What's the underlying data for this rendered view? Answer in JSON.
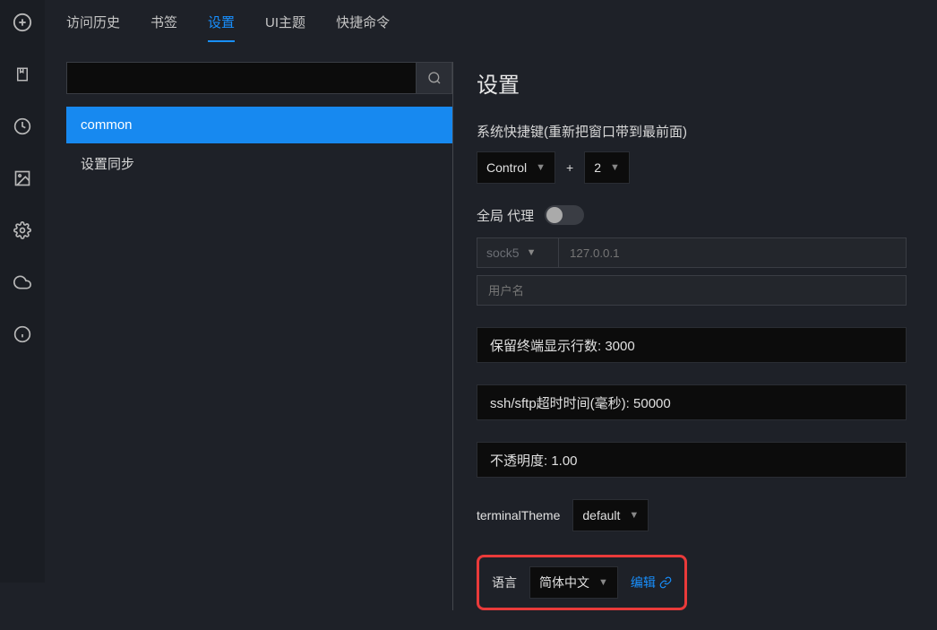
{
  "rail": {
    "icons": [
      "add-circle",
      "bookmark",
      "clock",
      "image",
      "gear",
      "cloud-sync",
      "info"
    ]
  },
  "tabs": [
    {
      "id": "history",
      "label": "访问历史",
      "active": false
    },
    {
      "id": "bookmarks",
      "label": "书签",
      "active": false
    },
    {
      "id": "settings",
      "label": "设置",
      "active": true
    },
    {
      "id": "themes",
      "label": "UI主题",
      "active": false
    },
    {
      "id": "quick",
      "label": "快捷命令",
      "active": false
    }
  ],
  "sidebar": {
    "items": [
      {
        "id": "common",
        "label": "common",
        "active": true
      },
      {
        "id": "sync",
        "label": "设置同步",
        "active": false
      }
    ]
  },
  "form": {
    "title": "设置",
    "hotkey": {
      "label": "系统快捷键(重新把窗口带到最前面)",
      "modifier": "Control",
      "plus": "+",
      "key": "2"
    },
    "proxy": {
      "label": "全局 代理",
      "enabled": false,
      "protocol": "sock5",
      "host_placeholder": "127.0.0.1",
      "user_placeholder": "用户名"
    },
    "buffer": {
      "display": "保留终端显示行数: 3000"
    },
    "timeout": {
      "display": "ssh/sftp超时时间(毫秒): 50000"
    },
    "opacity": {
      "display": "不透明度: 1.00"
    },
    "theme": {
      "label": "terminalTheme",
      "value": "default"
    },
    "language": {
      "label": "语言",
      "value": "简体中文",
      "edit": "编辑"
    }
  }
}
